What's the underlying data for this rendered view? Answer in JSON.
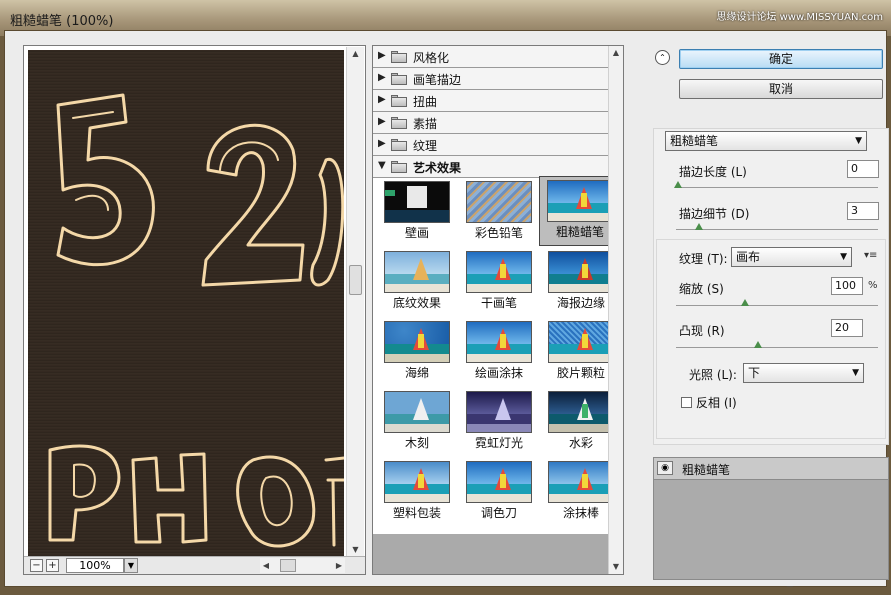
{
  "window": {
    "title": "粗糙蜡笔 (100%)",
    "watermark": "思缘设计论坛 www.MISSYUAN.com"
  },
  "preview": {
    "zoom_value": "100%",
    "zoom_minus": "−",
    "zoom_plus": "+"
  },
  "filter_categories": [
    {
      "label": "风格化"
    },
    {
      "label": "画笔描边"
    },
    {
      "label": "扭曲"
    },
    {
      "label": "素描"
    },
    {
      "label": "纹理"
    },
    {
      "label": "艺术效果"
    }
  ],
  "filter_thumbnails": [
    {
      "label": "壁画"
    },
    {
      "label": "彩色铅笔"
    },
    {
      "label": "粗糙蜡笔"
    },
    {
      "label": "底纹效果"
    },
    {
      "label": "干画笔"
    },
    {
      "label": "海报边缘"
    },
    {
      "label": "海绵"
    },
    {
      "label": "绘画涂抹"
    },
    {
      "label": "胶片颗粒"
    },
    {
      "label": "木刻"
    },
    {
      "label": "霓虹灯光"
    },
    {
      "label": "水彩"
    },
    {
      "label": "塑料包装"
    },
    {
      "label": "调色刀"
    },
    {
      "label": "涂抹棒"
    }
  ],
  "selected_filter": "粗糙蜡笔",
  "buttons": {
    "ok": "确定",
    "cancel": "取消"
  },
  "settings": {
    "filter_select": "粗糙蜡笔",
    "stroke_length_label": "描边长度 (L)",
    "stroke_length_value": "0",
    "stroke_detail_label": "描边细节 (D)",
    "stroke_detail_value": "3",
    "texture_label": "纹理 (T):",
    "texture_value": "画布",
    "scaling_label": "缩放 (S)",
    "scaling_value": "100",
    "scaling_unit": "%",
    "relief_label": "凸现 (R)",
    "relief_value": "20",
    "light_label": "光照 (L):",
    "light_value": "下",
    "invert_label": "反相 (I)"
  },
  "layers": {
    "items": [
      {
        "label": "粗糙蜡笔"
      }
    ]
  }
}
